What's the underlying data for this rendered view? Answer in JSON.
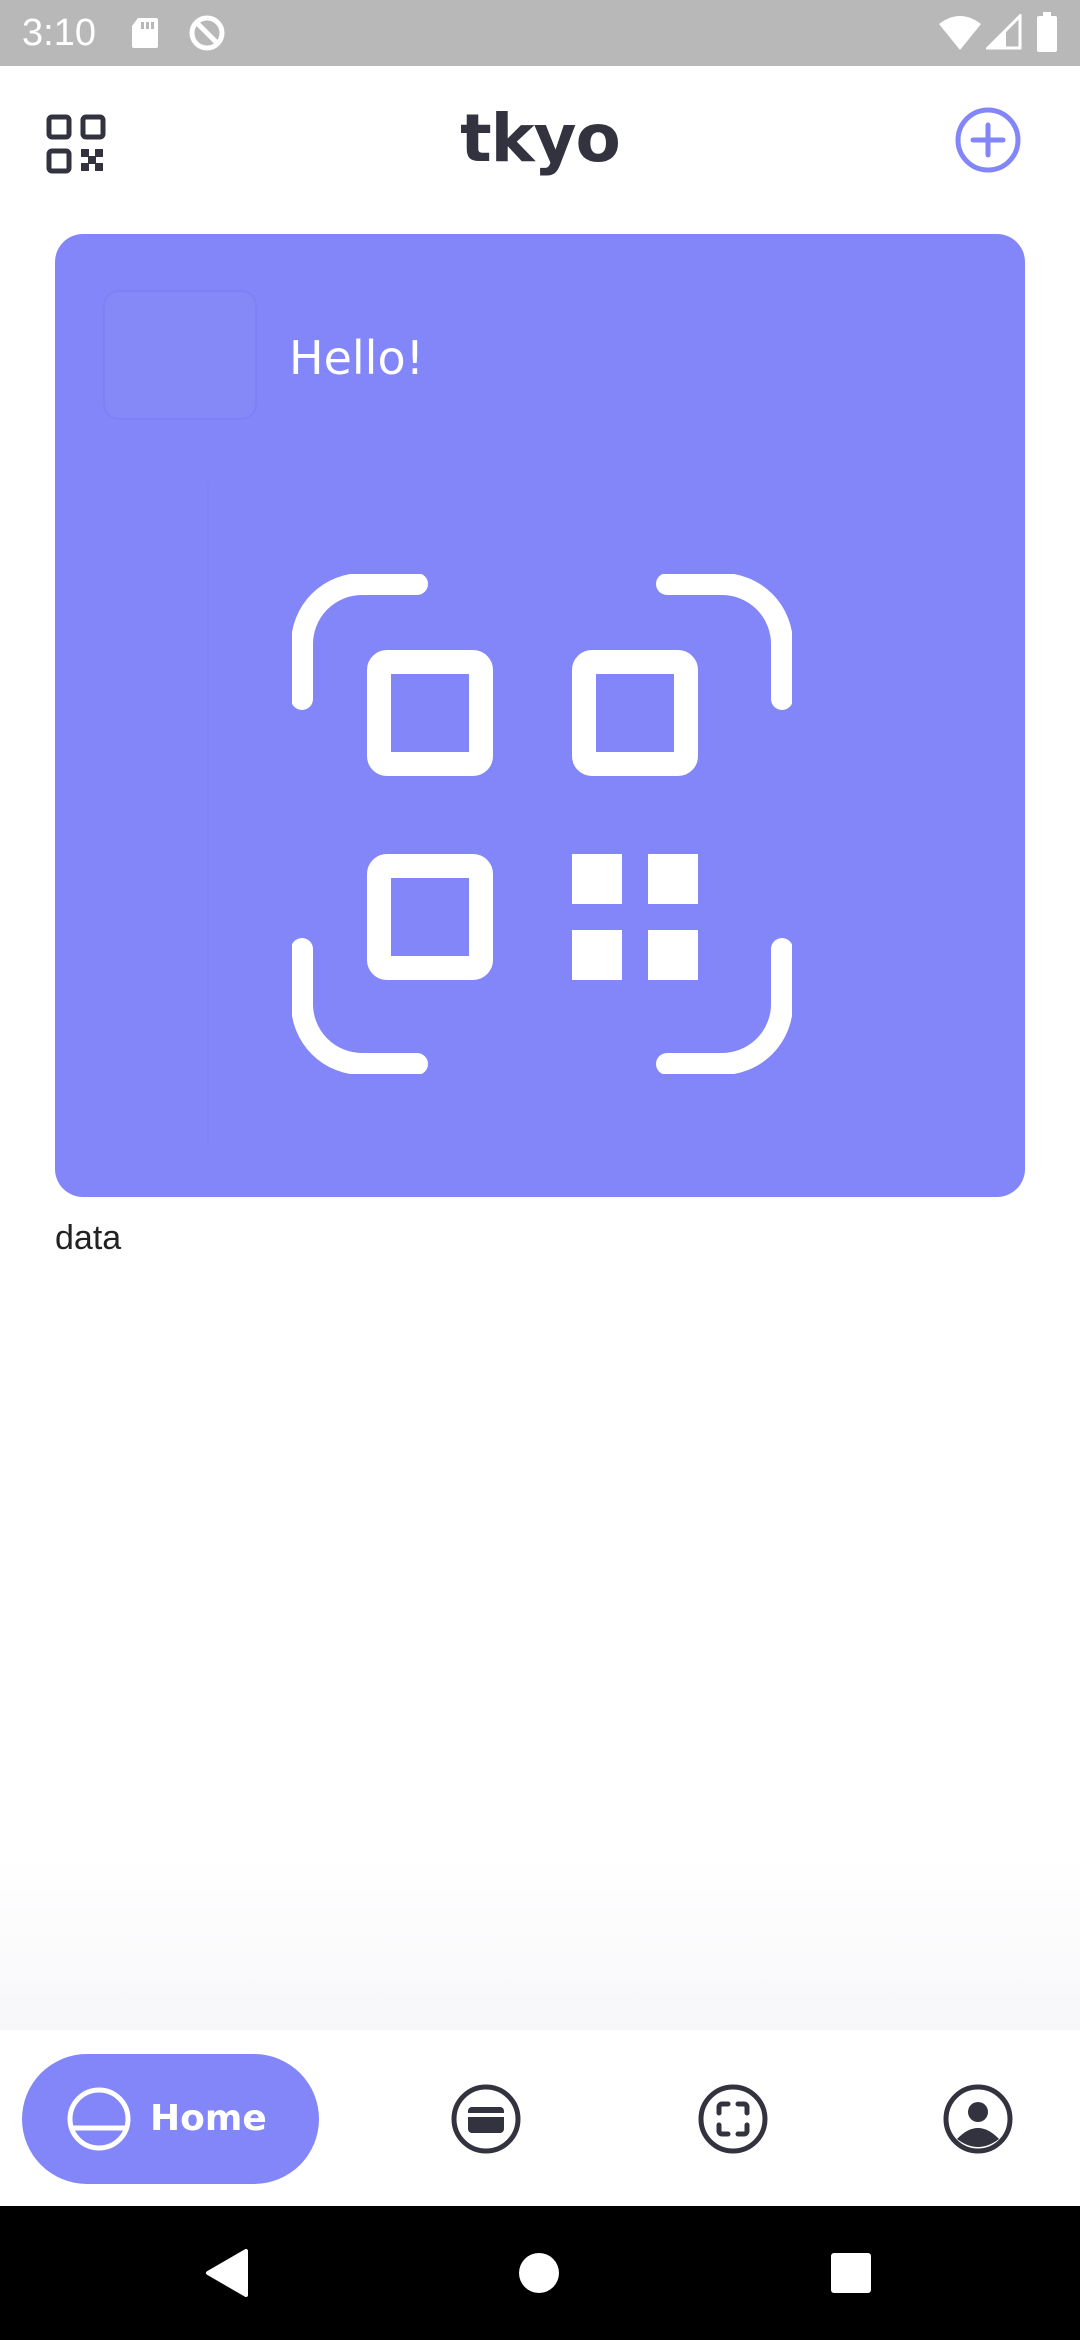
{
  "status_bar": {
    "time": "3:10",
    "icons": [
      "sd-card-icon",
      "do-not-disturb-icon",
      "wifi-icon",
      "signal-icon",
      "battery-icon"
    ]
  },
  "header": {
    "title": "tkyo",
    "left_icon": "qr-code-icon",
    "right_icon": "add-circle-icon"
  },
  "card": {
    "greeting": "Hello!",
    "icon": "qr-scan-icon",
    "caption": "data",
    "color": "#8286f8"
  },
  "bottom_nav": {
    "items": [
      {
        "label": "Home",
        "icon": "home-icon",
        "active": true
      },
      {
        "label": "",
        "icon": "wallet-icon",
        "active": false
      },
      {
        "label": "",
        "icon": "scan-icon",
        "active": false
      },
      {
        "label": "",
        "icon": "profile-icon",
        "active": false
      }
    ],
    "accent": "#8286f8"
  },
  "system_nav": {
    "buttons": [
      "back-icon",
      "home-circle-icon",
      "recents-icon"
    ]
  },
  "colors": {
    "accent": "#8286f8",
    "text_dark": "#333340",
    "status_bar": "#b8b8b8"
  }
}
